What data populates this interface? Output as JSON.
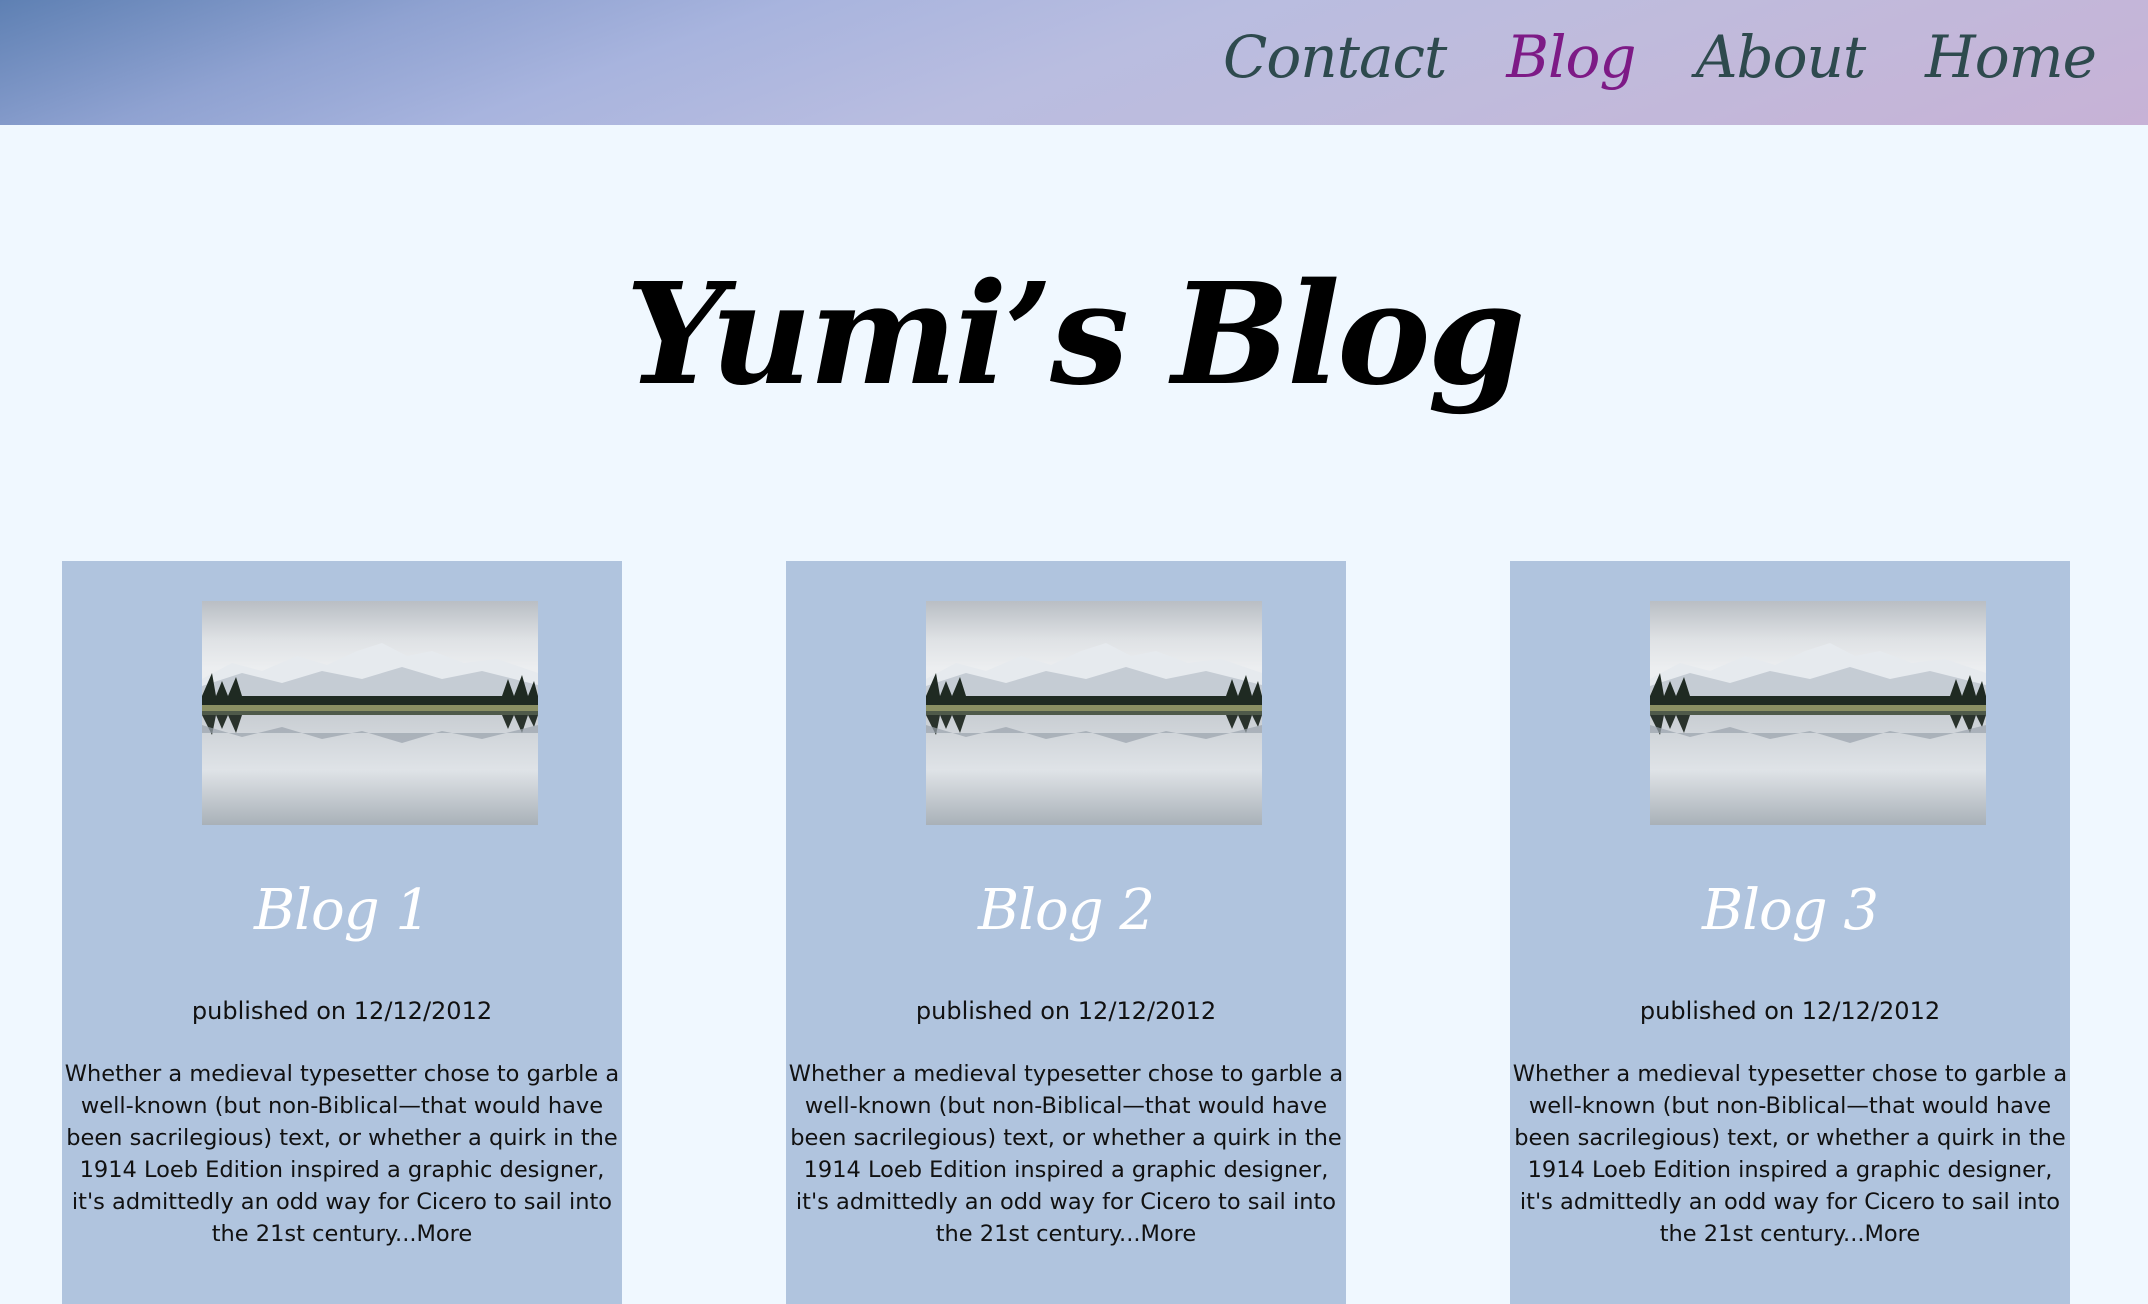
{
  "nav": {
    "items": [
      {
        "label": "Home",
        "active": false
      },
      {
        "label": "About",
        "active": false
      },
      {
        "label": "Blog",
        "active": true
      },
      {
        "label": "Contact",
        "active": false
      }
    ]
  },
  "page": {
    "title": "Yumi’s Blog"
  },
  "cards": [
    {
      "title": "Blog 1",
      "published": "published on 12/12/2012",
      "excerpt": "Whether a medieval typesetter chose to garble a well-known (but non-Biblical—that would have been sacrilegious) text, or whether a quirk in the 1914 Loeb Edition inspired a graphic designer, it's admittedly an odd way for Cicero to sail into the 21st century...",
      "more": "More"
    },
    {
      "title": "Blog 2",
      "published": "published on 12/12/2012",
      "excerpt": "Whether a medieval typesetter chose to garble a well-known (but non-Biblical—that would have been sacrilegious) text, or whether a quirk in the 1914 Loeb Edition inspired a graphic designer, it's admittedly an odd way for Cicero to sail into the 21st century...",
      "more": "More"
    },
    {
      "title": "Blog 3",
      "published": "published on 12/12/2012",
      "excerpt": "Whether a medieval typesetter chose to garble a well-known (but non-Biblical—that would have been sacrilegious) text, or whether a quirk in the 1914 Loeb Edition inspired a graphic designer, it's admittedly an odd way for Cicero to sail into the 21st century...",
      "more": "More"
    }
  ],
  "colors": {
    "background": "#f0f8ff",
    "card": "#b0c4de",
    "nav_text": "#2e4a4e",
    "nav_active": "#7d1a86",
    "card_title": "#ffffff"
  },
  "icons": {
    "card_image": "mountain-lake-reflection-image"
  }
}
